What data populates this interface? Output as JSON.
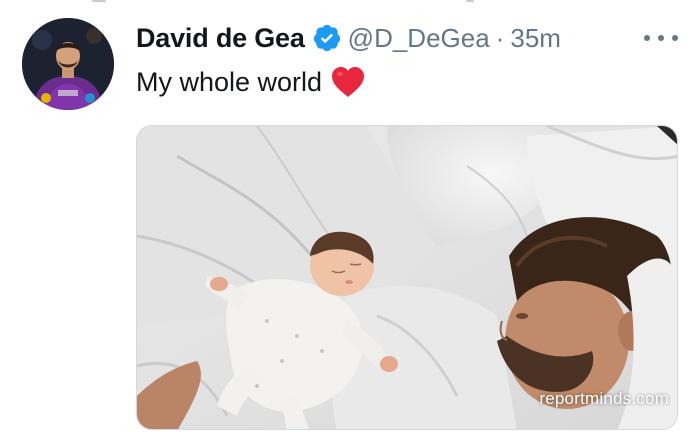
{
  "tweet": {
    "display_name": "David de Gea",
    "handle": "@D_DeGea",
    "separator": "·",
    "time": "35m",
    "text": "My whole world",
    "emoji": "red-heart",
    "verified": true
  },
  "media": {
    "watermark": "reportminds.com"
  },
  "icons": {
    "verified": "verified-badge-icon",
    "more": "more-options-icon"
  },
  "colors": {
    "verified_blue": "#1d9bf0",
    "heart_red": "#e8263d",
    "secondary_text": "#657786",
    "primary_text": "#14171a"
  }
}
